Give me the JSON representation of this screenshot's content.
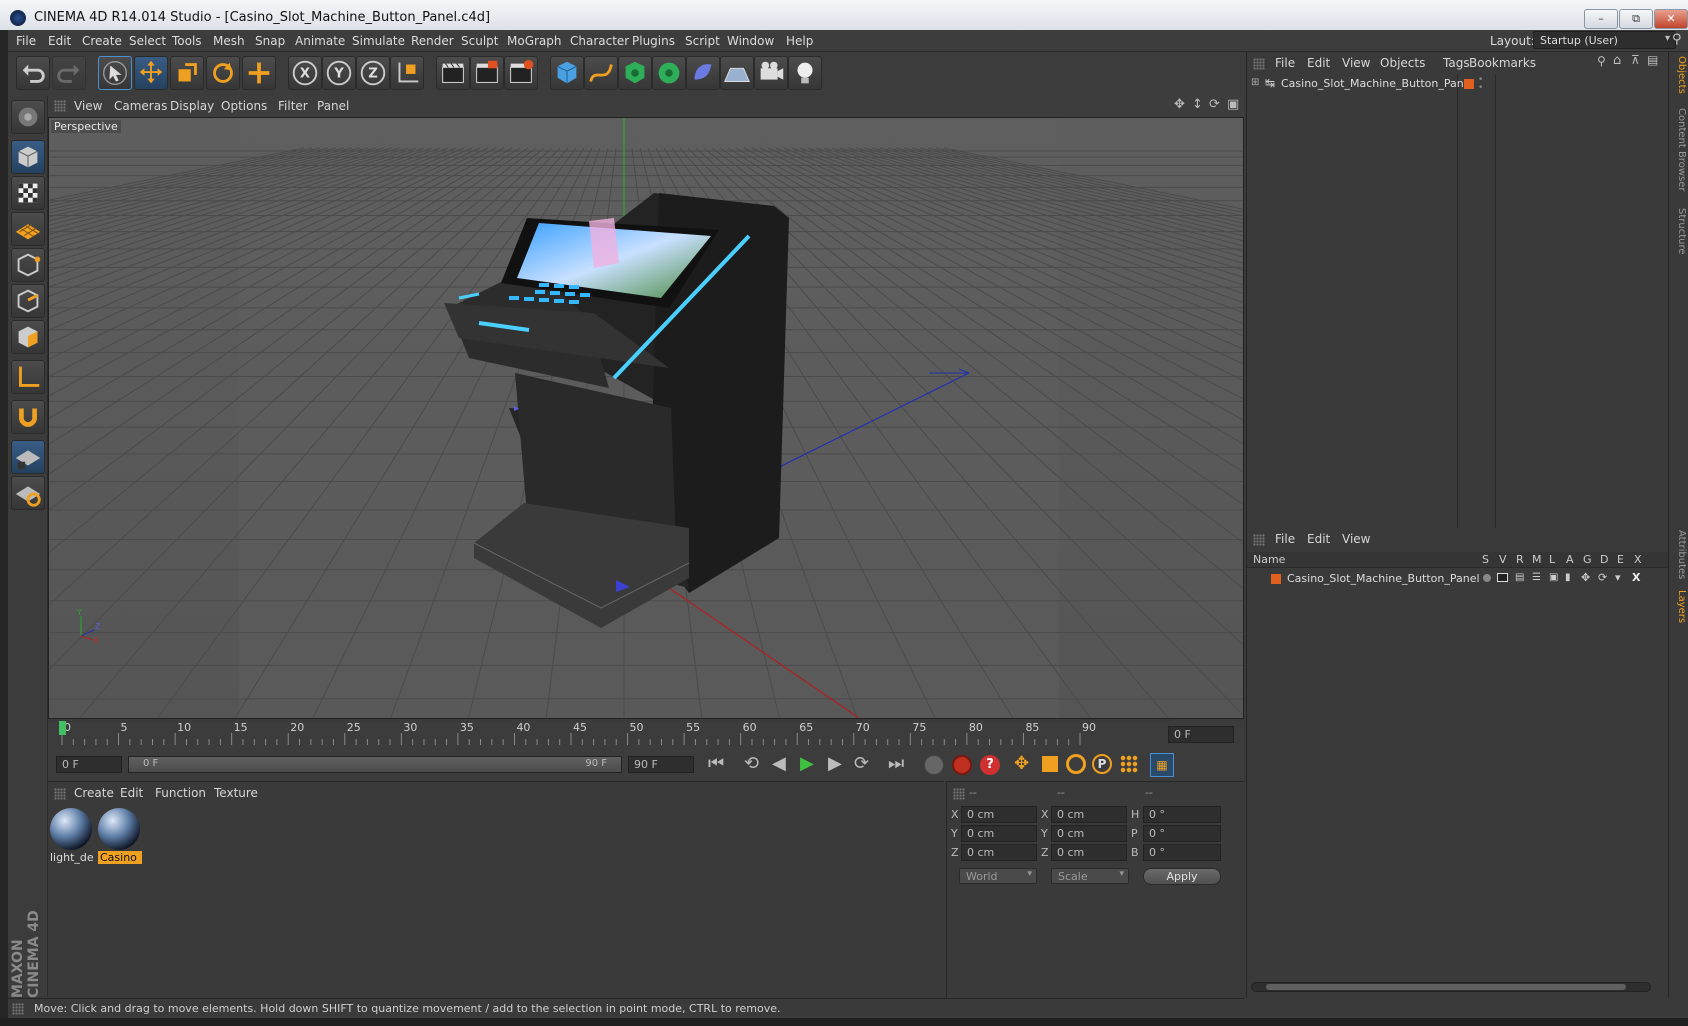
{
  "window": {
    "title": "CINEMA 4D R14.014 Studio - [Casino_Slot_Machine_Button_Panel.c4d]",
    "buttons": [
      "minimize-icon",
      "maximize-icon",
      "close-icon"
    ]
  },
  "menubar": {
    "items": [
      "File",
      "Edit",
      "Create",
      "Select",
      "Tools",
      "Mesh",
      "Snap",
      "Animate",
      "Simulate",
      "Render",
      "Sculpt",
      "MoGraph",
      "Character",
      "Plugins",
      "Script",
      "Window",
      "Help"
    ],
    "layout_label": "Layout:",
    "layout_value": "Startup (User)"
  },
  "toolbar": {
    "icons": [
      "undo-icon",
      "redo-icon",
      "select-arrow-icon",
      "move-icon",
      "scale-icon",
      "rotate-icon",
      "create-plus-icon",
      "x-axis-icon",
      "y-axis-icon",
      "z-axis-icon",
      "coordinate-system-icon",
      "render-view-icon",
      "render-picture-viewer-icon",
      "render-settings-icon",
      "cube-primitive-icon",
      "spline-icon",
      "nurbs-icon",
      "array-icon",
      "deformer-icon",
      "floor-icon",
      "camera-icon",
      "light-icon"
    ]
  },
  "left_tools": {
    "icons": [
      "make-editable-icon",
      "model-mode-icon",
      "texture-mode-icon",
      "workplane-icon",
      "points-mode-icon",
      "edges-mode-icon",
      "polygons-mode-icon",
      "axis-mode-icon",
      "magnet-icon",
      "snap-grid-icon",
      "sculpt-icon"
    ]
  },
  "viewport": {
    "menu": [
      "View",
      "Cameras",
      "Display",
      "Options",
      "Filter",
      "Panel"
    ],
    "label": "Perspective",
    "axis_labels": {
      "y": "Y",
      "z": "Z",
      "x": "X"
    }
  },
  "timeline": {
    "ticks": [
      "0",
      "5",
      "10",
      "15",
      "20",
      "25",
      "30",
      "35",
      "40",
      "45",
      "50",
      "55",
      "60",
      "65",
      "70",
      "75",
      "80",
      "85",
      "90"
    ],
    "frame_field": "0 F",
    "current_frame": 0,
    "max_frame": 90
  },
  "transport": {
    "start_field": "0 F",
    "range_left": "0 F",
    "range_right": "90 F",
    "end_field": "90 F"
  },
  "materials": {
    "menu": [
      "Create",
      "Edit",
      "Function",
      "Texture"
    ],
    "items": [
      {
        "name": "light_de",
        "selected": false
      },
      {
        "name": "Casino",
        "selected": true
      }
    ]
  },
  "coordinates": {
    "headers": [
      "--",
      "--",
      "--"
    ],
    "rows": [
      {
        "a": "X",
        "av": "0 cm",
        "b": "X",
        "bv": "0 cm",
        "c": "H",
        "cv": "0 °"
      },
      {
        "a": "Y",
        "av": "0 cm",
        "b": "Y",
        "bv": "0 cm",
        "c": "P",
        "cv": "0 °"
      },
      {
        "a": "Z",
        "av": "0 cm",
        "b": "Z",
        "bv": "0 cm",
        "c": "B",
        "cv": "0 °"
      }
    ],
    "mode_select": "World",
    "scale_select": "Scale",
    "apply_label": "Apply"
  },
  "object_manager": {
    "menu": [
      "File",
      "Edit",
      "View",
      "Objects",
      "Tags",
      "Bookmarks"
    ],
    "object_name": "Casino_Slot_Machine_Button_Panel"
  },
  "layer_manager": {
    "menu": [
      "File",
      "Edit",
      "View"
    ],
    "col_name": "Name",
    "col_flags": [
      "S",
      "V",
      "R",
      "M",
      "L",
      "A",
      "G",
      "D",
      "E",
      "X"
    ],
    "layer_name": "Casino_Slot_Machine_Button_Panel"
  },
  "right_tabs": {
    "top": [
      "Objects",
      "Content Browser",
      "Structure"
    ],
    "bottom": [
      "Attributes",
      "Layers"
    ]
  },
  "statusbar": {
    "text": "Move: Click and drag to move elements. Hold down SHIFT to quantize movement / add to the selection in point mode, CTRL to remove."
  },
  "branding": {
    "logo_text": "MAXON CINEMA 4D"
  },
  "colors": {
    "accent_orange": "#f0a020",
    "selection_blue": "#4a90d0",
    "layer_orange": "#e06020"
  }
}
